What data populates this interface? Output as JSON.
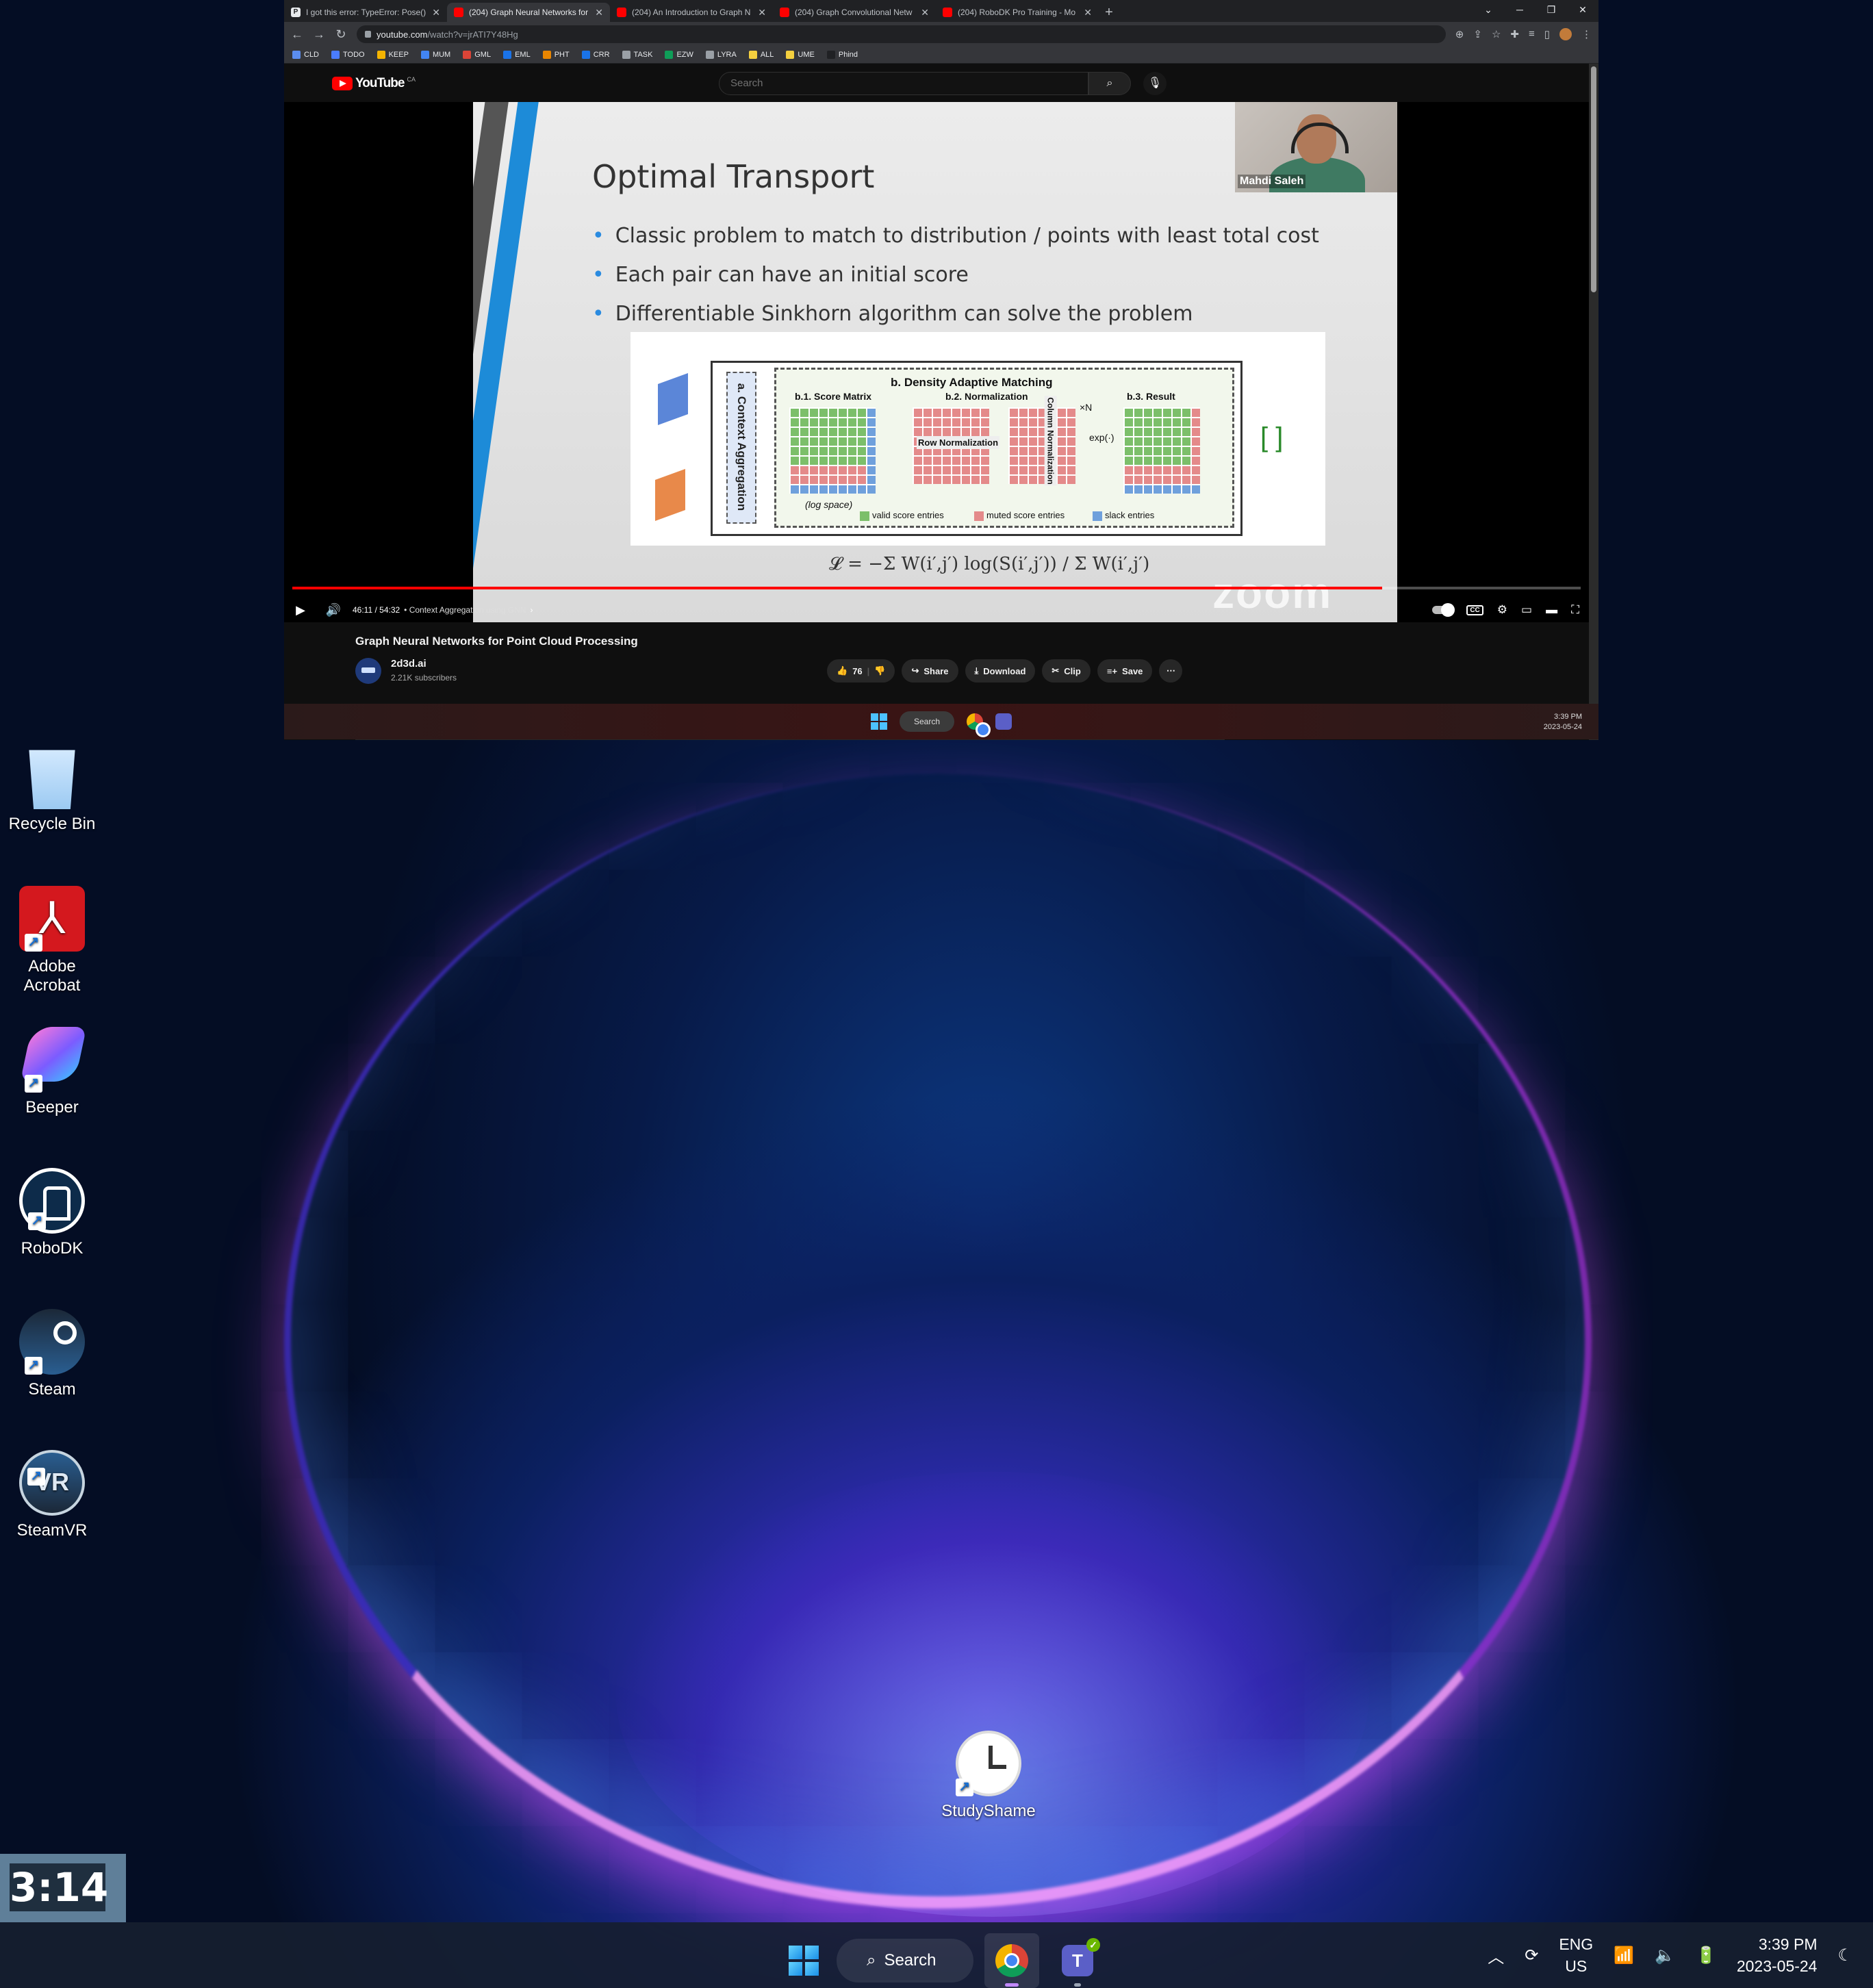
{
  "browser": {
    "tabs": [
      {
        "icon": "P",
        "title": "I got this error: TypeError: Pose()"
      },
      {
        "icon": "youtube",
        "title": "(204) Graph Neural Networks for"
      },
      {
        "icon": "youtube",
        "title": "(204) An Introduction to Graph N"
      },
      {
        "icon": "youtube",
        "title": "(204) Graph Convolutional Netw"
      },
      {
        "icon": "youtube",
        "title": "(204) RoboDK Pro Training - Mo"
      }
    ],
    "url_host": "youtube.com",
    "url_path": "/watch?v=jrATI7Y48Hg",
    "bookmarks": [
      {
        "label": "CLD",
        "color": "#5b8def"
      },
      {
        "label": "TODO",
        "color": "#4a7cff"
      },
      {
        "label": "KEEP",
        "color": "#f4b400"
      },
      {
        "label": "MUM",
        "color": "#4285f4"
      },
      {
        "label": "GML",
        "color": "#db4437"
      },
      {
        "label": "EML",
        "color": "#1a73e8"
      },
      {
        "label": "PHT",
        "color": "#ea8600"
      },
      {
        "label": "CRR",
        "color": "#1a73e8"
      },
      {
        "label": "TASK",
        "color": "#9aa0a6"
      },
      {
        "label": "EZW",
        "color": "#0f9d58"
      },
      {
        "label": "LYRA",
        "color": "#9aa0a6"
      },
      {
        "label": "ALL",
        "color": "#f4d03f"
      },
      {
        "label": "UME",
        "color": "#f4d03f"
      },
      {
        "label": "Phind",
        "color": "#202124"
      }
    ]
  },
  "youtube": {
    "logo_text": "YouTube",
    "region": "CA",
    "search_placeholder": "Search",
    "video": {
      "progress": 0.846,
      "time": "46:11 / 54:32",
      "chapter": "• Context Aggregation using GNN",
      "slide": {
        "title": "Optimal Transport",
        "bullets": [
          "Classic problem to match to distribution / points with least total cost",
          "Each pair can have an initial score",
          "Differentiable Sinkhorn algorithm can solve the problem"
        ],
        "figure": {
          "context": "a. Context Aggregation",
          "dam": "b. Density Adaptive Matching",
          "score_matrix": "b.1. Score Matrix",
          "normalization": "b.2. Normalization",
          "result": "b.3. Result",
          "row_norm": "Row Normalization",
          "col_norm": "Column Normalization",
          "log_space": "(log space)",
          "times_n": "×N",
          "exp": "exp(·)",
          "legend_valid": "valid score entries",
          "legend_muted": "muted score entries",
          "legend_slack": "slack entries"
        },
        "speaker": "Mahdi Saleh",
        "watermark": "zoom"
      }
    },
    "title": "Graph Neural Networks for Point Cloud Processing",
    "channel": "2d3d.ai",
    "subscribers": "2.21K subscribers",
    "likes": "76",
    "actions": {
      "share": "Share",
      "download": "Download",
      "clip": "Clip",
      "save": "Save"
    }
  },
  "inner_taskbar": {
    "search": "Search",
    "time": "3:39 PM",
    "date": "2023-05-24"
  },
  "desktop": {
    "icons": [
      "Recycle Bin",
      "Adobe Acrobat",
      "Beeper",
      "RoboDK",
      "Steam",
      "SteamVR"
    ],
    "study": "StudyShame",
    "timer": "3:14"
  },
  "taskbar": {
    "search": "Search",
    "lang1": "ENG",
    "lang2": "US",
    "time": "3:39 PM",
    "date": "2023-05-24"
  }
}
